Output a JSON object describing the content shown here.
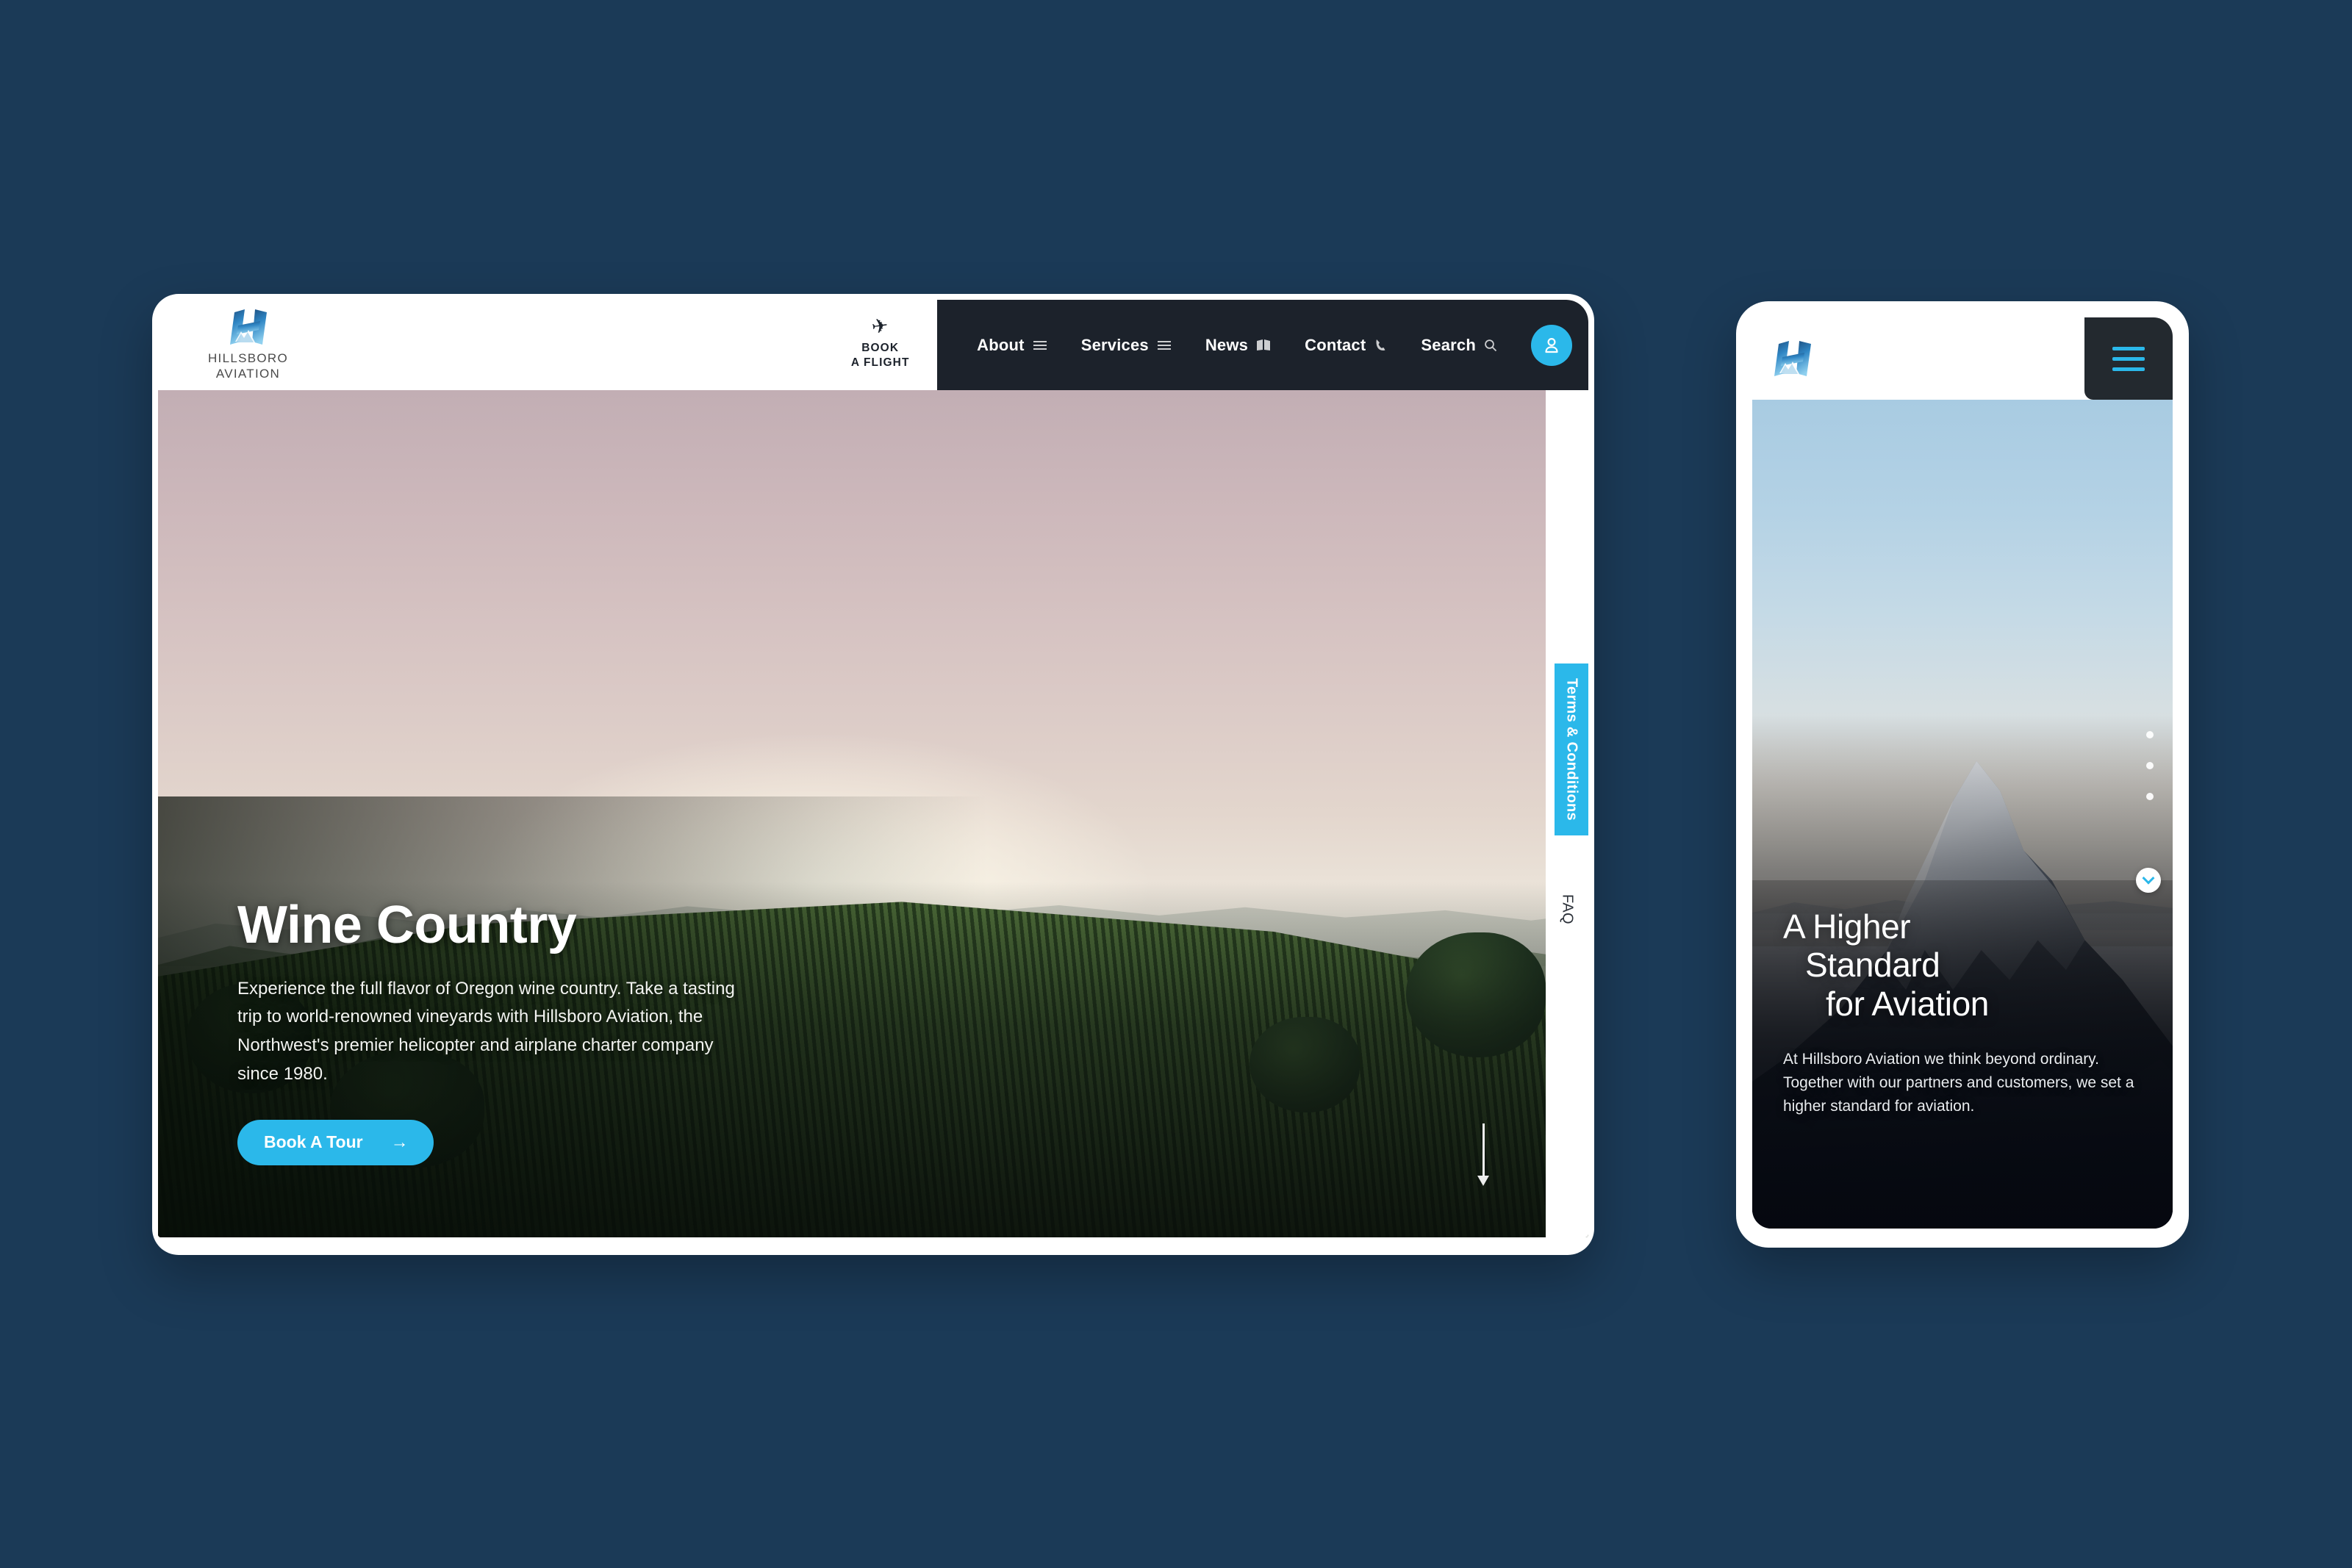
{
  "theme": {
    "page_background": "#1b3a57",
    "accent_cyan": "#2bb8ea",
    "nav_dark": "#1c222b",
    "frame_white": "#ffffff"
  },
  "desktop": {
    "brand": {
      "logo_icon": "hillsboro-h-mountain-logo",
      "name_line1": "HILLSBORO",
      "name_line2": "AVIATION"
    },
    "book_flight": {
      "icon": "airplane-takeoff-icon",
      "line1": "BOOK",
      "line2": "A FLIGHT"
    },
    "nav_items": [
      {
        "label": "About",
        "icon": "list-lines-icon"
      },
      {
        "label": "Services",
        "icon": "list-lines-icon"
      },
      {
        "label": "News",
        "icon": "open-book-icon"
      },
      {
        "label": "Contact",
        "icon": "phone-icon"
      },
      {
        "label": "Search",
        "icon": "magnifier-icon"
      }
    ],
    "account_button": {
      "icon": "user-account-icon",
      "color": "#2bb8ea"
    },
    "hero": {
      "title": "Wine Country",
      "description": "Experience the full flavor of Oregon wine country. Take a tasting trip to world-renowned vineyards with Hillsboro Aviation, the Northwest's premier helicopter and airplane charter company since 1980.",
      "cta_label": "Book A Tour",
      "cta_icon": "arrow-right-icon",
      "scroll_cue_icon": "arrow-down-icon",
      "image_subject": "aerial view of sunlit Oregon vineyard hills at dawn"
    },
    "side_rail": {
      "terms_label": "Terms & Conditions",
      "faq_label": "FAQ"
    }
  },
  "mobile": {
    "brand": {
      "logo_icon": "hillsboro-h-mountain-logo"
    },
    "menu_button": {
      "icon": "hamburger-menu-icon",
      "color": "#2bb8ea"
    },
    "hero": {
      "title_line1": "A Higher",
      "title_line2": "Standard",
      "title_line3": "for Aviation",
      "description": "At Hillsboro Aviation we think beyond ordinary. Together with our partners and customers, we set a higher standard for aviation.",
      "image_subject": "snow-capped Mount Hood peak at dawn",
      "carousel_dots": 3,
      "scroll_button_icon": "chevron-down-icon"
    }
  }
}
